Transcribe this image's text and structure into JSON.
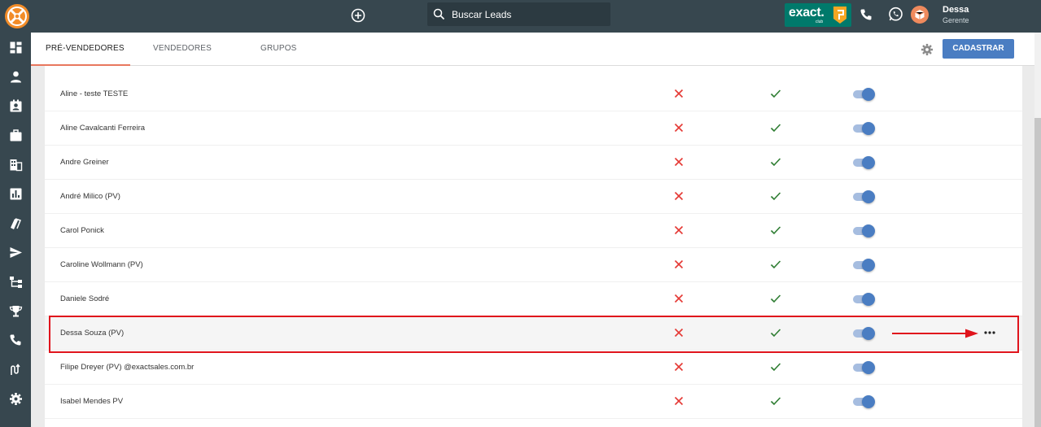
{
  "topbar": {
    "logo_icon": "exact-sales-logo",
    "add_icon": "plus-circle-icon",
    "search_placeholder": "Buscar Leads",
    "search_icon": "search-icon",
    "badge_text": "exact.",
    "badge_sub": "club",
    "phone_icon": "phone-icon",
    "whatsapp_icon": "whatsapp-icon",
    "user": {
      "name": "Dessa",
      "role": "Gerente"
    }
  },
  "sidebar": {
    "items": [
      {
        "icon": "dashboard-icon"
      },
      {
        "icon": "person-icon"
      },
      {
        "icon": "contact-card-icon"
      },
      {
        "icon": "briefcase-icon"
      },
      {
        "icon": "building-icon"
      },
      {
        "icon": "chart-icon"
      },
      {
        "icon": "tags-icon"
      },
      {
        "icon": "send-icon"
      },
      {
        "icon": "hierarchy-icon"
      },
      {
        "icon": "trophy-icon"
      },
      {
        "icon": "phone-icon"
      },
      {
        "icon": "routes-icon"
      },
      {
        "icon": "gear-icon"
      }
    ]
  },
  "tabs": [
    {
      "label": "PRÉ-VENDEDORES",
      "active": true
    },
    {
      "label": "VENDEDORES",
      "active": false
    },
    {
      "label": "GRUPOS",
      "active": false
    }
  ],
  "actions": {
    "settings_icon": "gear-icon",
    "cadastrar": "CADASTRAR"
  },
  "rows": [
    {
      "name": "Aline - teste TESTE",
      "col1": "x",
      "col2": "check",
      "active": true
    },
    {
      "name": "Aline Cavalcanti Ferreira",
      "col1": "x",
      "col2": "check",
      "active": true
    },
    {
      "name": "Andre Greiner",
      "col1": "x",
      "col2": "check",
      "active": true
    },
    {
      "name": "André Milico (PV)",
      "col1": "x",
      "col2": "check",
      "active": true
    },
    {
      "name": "Carol Ponick",
      "col1": "x",
      "col2": "check",
      "active": true
    },
    {
      "name": "Caroline Wollmann (PV)",
      "col1": "x",
      "col2": "check",
      "active": true
    },
    {
      "name": "Daniele Sodré",
      "col1": "x",
      "col2": "check",
      "active": true
    },
    {
      "name": "Dessa Souza (PV)",
      "col1": "x",
      "col2": "check",
      "active": true,
      "highlighted": true
    },
    {
      "name": "Filipe Dreyer (PV) @exactsales.com.br",
      "col1": "x",
      "col2": "check",
      "active": true
    },
    {
      "name": "Isabel Mendes PV",
      "col1": "x",
      "col2": "check",
      "active": true
    }
  ],
  "colors": {
    "topbar": "#37474f",
    "accent": "#4a7dc2",
    "tab_underline": "#e8775e",
    "x_red": "#e53935",
    "check_green": "#2e7d32",
    "annotation_red": "#e0141c"
  }
}
